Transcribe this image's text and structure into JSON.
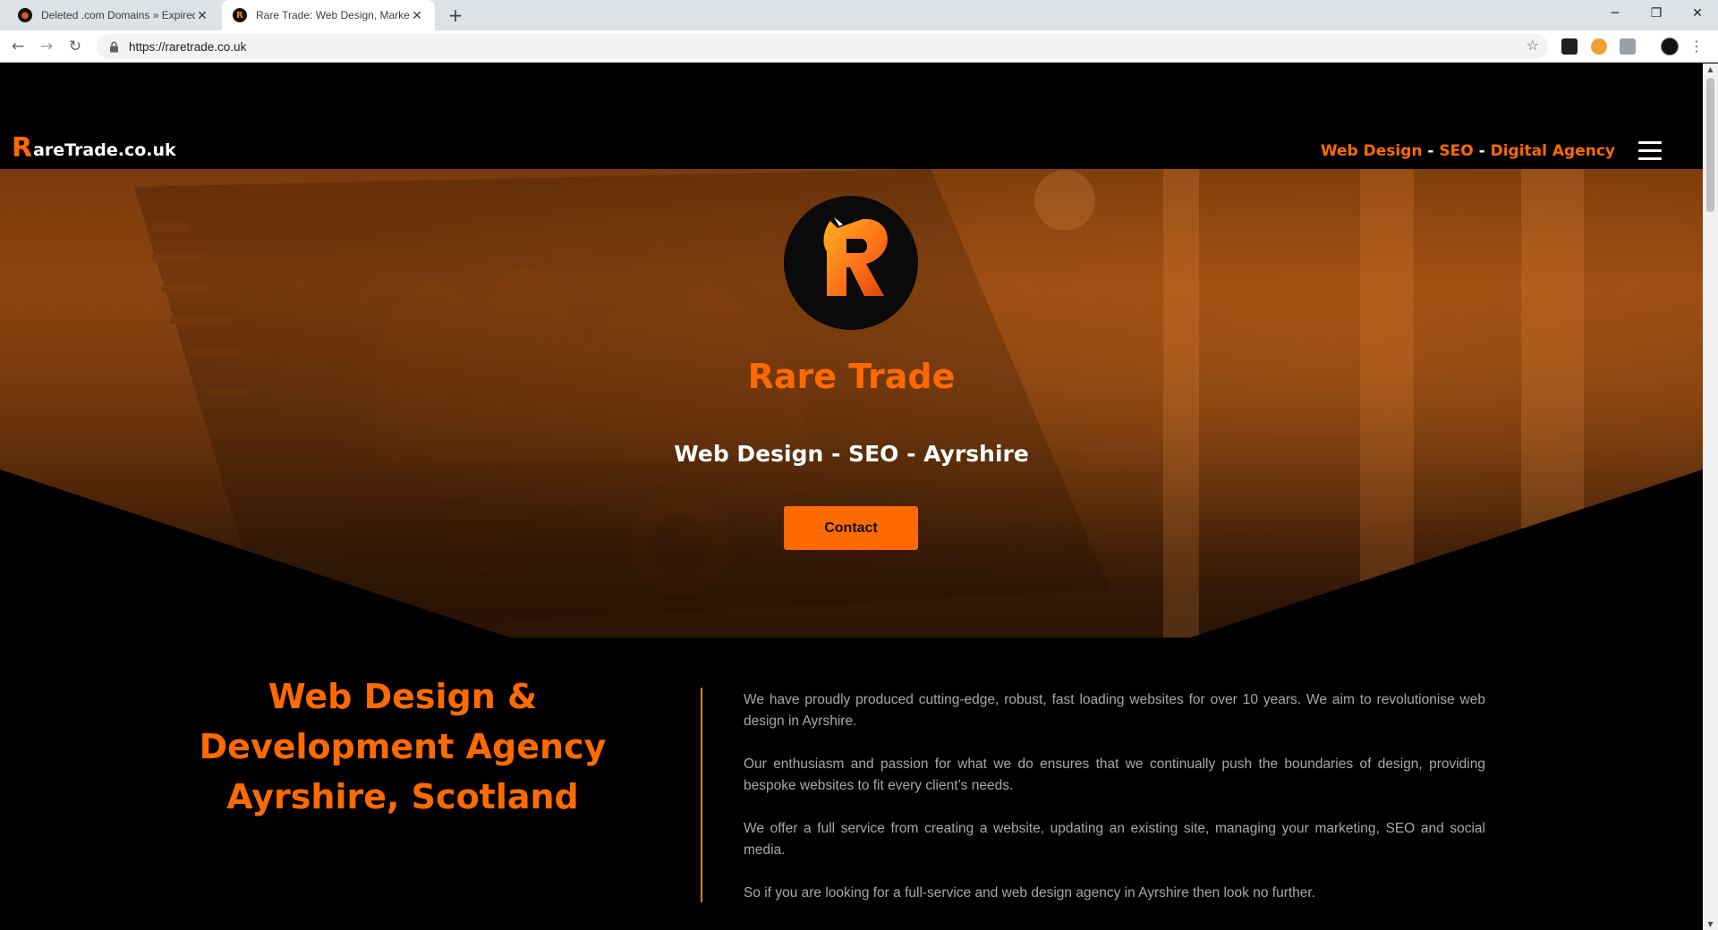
{
  "browser": {
    "tabs": [
      {
        "title": "Deleted .com Domains » Expired",
        "active": false
      },
      {
        "title": "Rare Trade: Web Design, Marketi",
        "active": true
      }
    ],
    "new_tab_icon": "plus-icon",
    "url": "https://raretrade.co.uk",
    "window_controls": [
      "minimize-icon",
      "restore-icon",
      "close-icon"
    ]
  },
  "header": {
    "brand_initial": "R",
    "brand_rest": "areTrade.co.uk",
    "tagline_parts": [
      "Web Design",
      " - ",
      "SEO",
      " - ",
      "Digital Agency"
    ],
    "menu_icon": "hamburger-icon"
  },
  "hero": {
    "logo_letter": "R",
    "title": "Rare Trade",
    "subtitle": "Web Design - SEO - Ayrshire",
    "cta_label": "Contact"
  },
  "about": {
    "heading_lines": [
      "Web Design &",
      "Development Agency",
      "Ayrshire, Scotland"
    ],
    "paragraphs": [
      "We have proudly produced cutting-edge, robust, fast loading websites for over 10 years. We aim to revolutionise web design in Ayrshire.",
      "Our enthusiasm and passion for what we do ensures that we continually push the boundaries of design, providing bespoke websites to fit every client’s needs.",
      "We offer a full service from creating a website, updating an existing site, managing your marketing, SEO and social media.",
      "So if you are looking for a full-service and web design agency in Ayrshire then look no further."
    ]
  },
  "colors": {
    "brand_orange": "#ff6a00",
    "page_background": "#000000",
    "body_text": "#a7a7a7",
    "divider": "#c98a1a"
  }
}
